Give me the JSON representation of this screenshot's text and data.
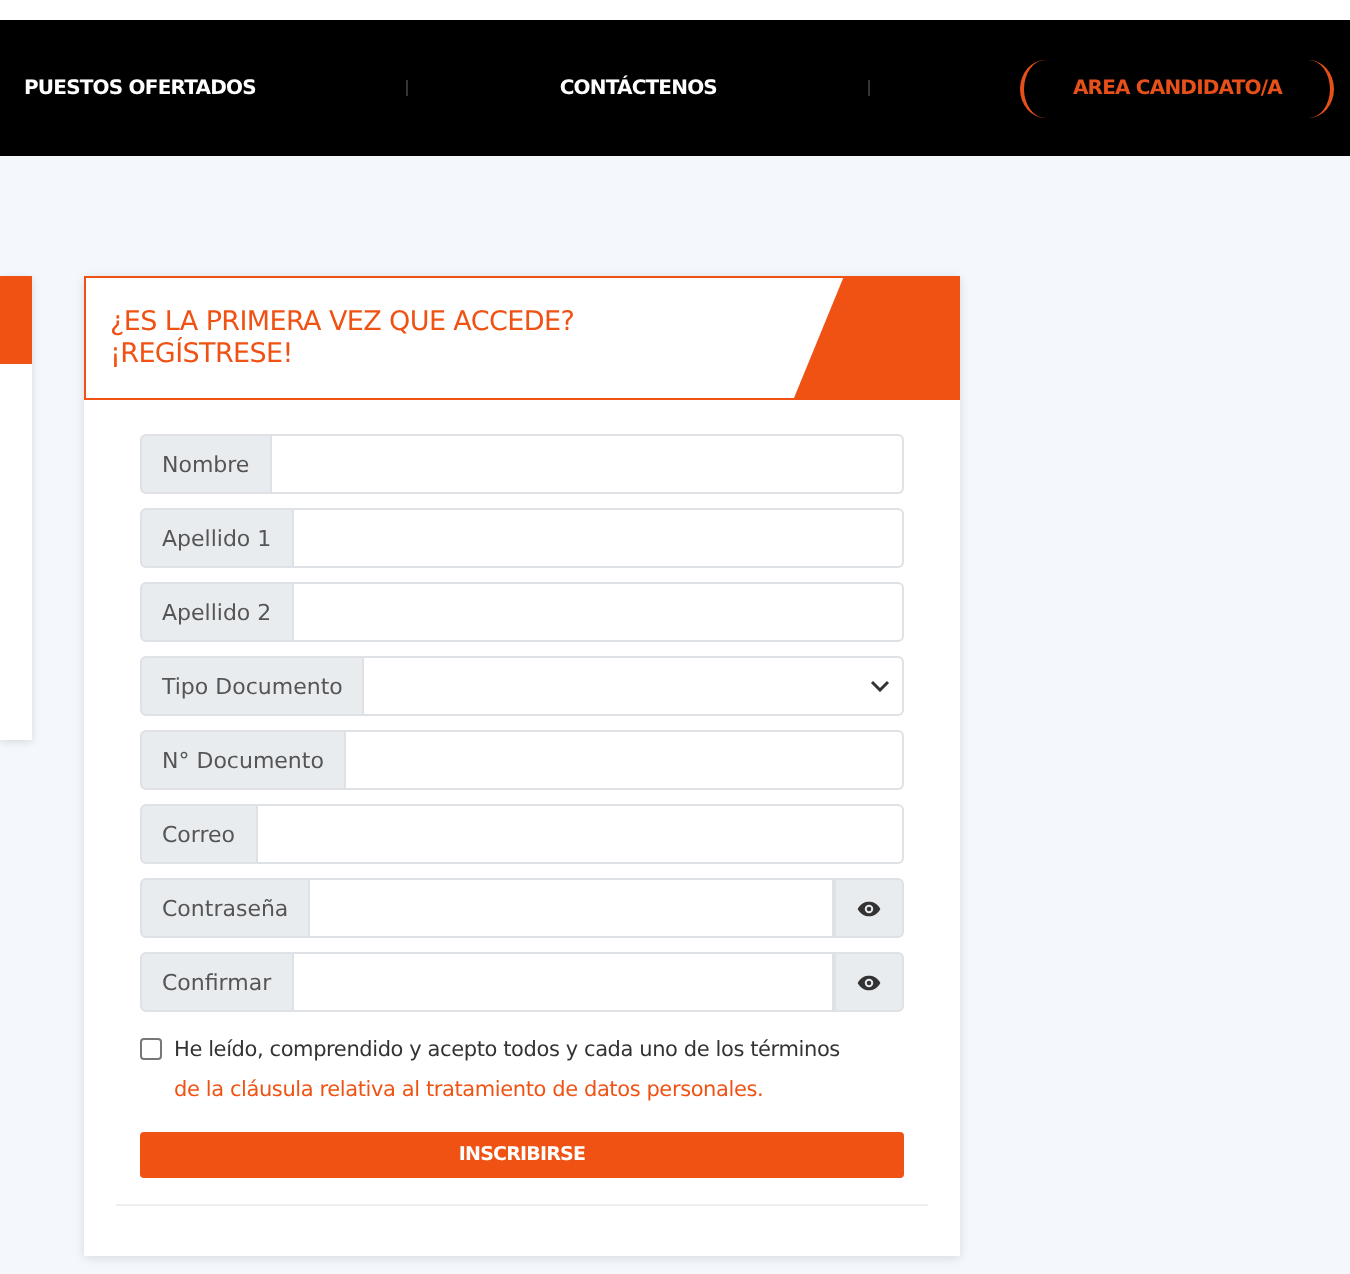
{
  "nav": {
    "items": [
      {
        "label": "PUESTOS OFERTADOS",
        "selected": false
      },
      {
        "label": "CONTÁCTENOS",
        "selected": false
      },
      {
        "label": "AREA CANDIDATO/A",
        "selected": true
      }
    ]
  },
  "form": {
    "title": "¿ES LA PRIMERA VEZ QUE ACCEDE?",
    "subtitle": "¡REGÍSTRESE!",
    "fields": [
      {
        "label": "Nombre",
        "kind": "text"
      },
      {
        "label": "Apellido 1",
        "kind": "text"
      },
      {
        "label": "Apellido 2",
        "kind": "text"
      },
      {
        "label": "Tipo Documento",
        "kind": "select"
      },
      {
        "label": "N° Documento",
        "kind": "text"
      },
      {
        "label": "Correo",
        "kind": "text"
      },
      {
        "label": "Contraseña",
        "kind": "password"
      },
      {
        "label": "Confirmar",
        "kind": "password"
      }
    ],
    "consent": {
      "checked": false,
      "text": "He leído, comprendido y acepto todos y cada uno de los términos",
      "link": "de la cláusula relativa al tratamiento de datos personales."
    },
    "submit": "INSCRIBIRSE"
  }
}
